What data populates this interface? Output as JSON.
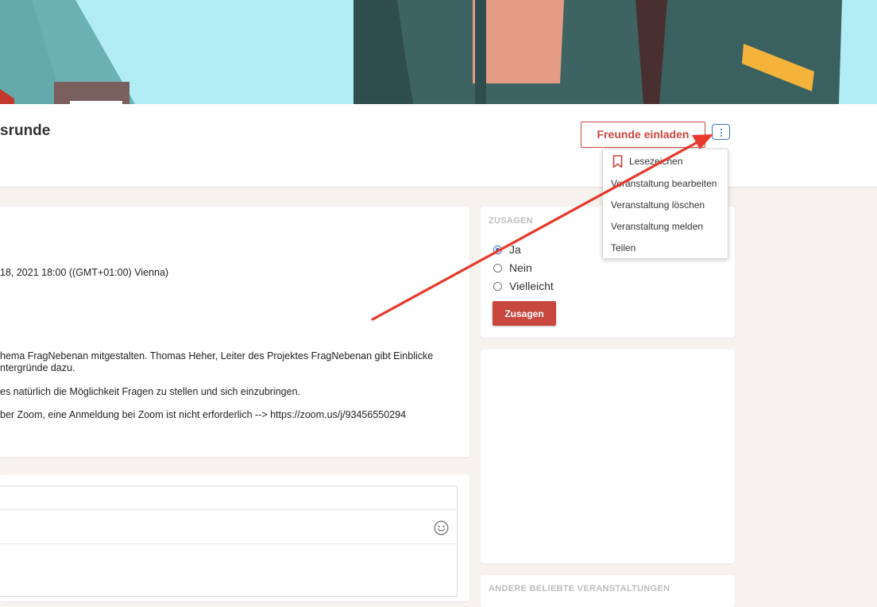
{
  "header": {
    "title": "srunde",
    "invite_label": "Freunde einladen"
  },
  "menu": {
    "items": [
      "Lesezeichen",
      "Veranstaltung bearbeiten",
      "Veranstaltung löschen",
      "Veranstaltung melden",
      "Teilen"
    ]
  },
  "details": {
    "date_line": " 18, 2021 18:00 ((GMT+01:00) Vienna)",
    "desc_line1": "hema FragNebenan mitgestalten. Thomas Heher, Leiter des Projektes FragNebenan gibt Einblicke",
    "desc_line2": "ntergründe dazu.",
    "desc_line3": " es natürlich die Möglichkeit Fragen zu stellen und sich einzubringen.",
    "desc_line4": "ber Zoom, eine Anmeldung bei Zoom ist nicht erforderlich --> https://zoom.us/j/93456550294"
  },
  "rsvp": {
    "heading": "ZUSAGEN",
    "options": [
      "Ja",
      "Nein",
      "Vielleicht"
    ],
    "selected": "Ja",
    "submit_label": "Zusagen"
  },
  "comment": {
    "placeholder": ""
  },
  "sidebar": {
    "other_heading": "ANDERE BELIEBTE VERANSTALTUNGEN"
  },
  "colors": {
    "accent": "#c8473e",
    "focus": "#3b73c8",
    "background": "#f6f3ee",
    "hero": "#b2ecf4"
  }
}
